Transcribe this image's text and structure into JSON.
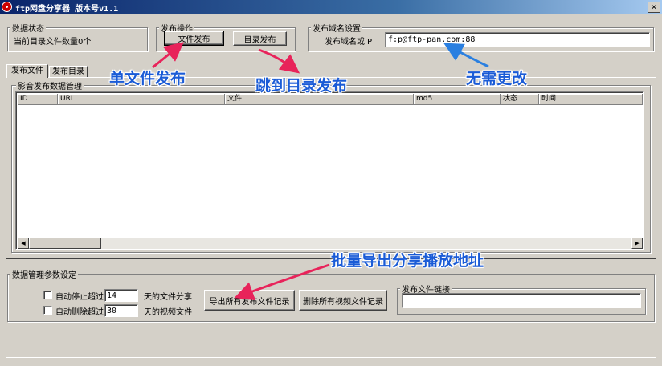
{
  "window": {
    "title": "ftp网盘分享器  版本号v1.1",
    "close_glyph": "×"
  },
  "data_status": {
    "title": "数据状态",
    "text": "当前目录文件数量0个"
  },
  "publish_ops": {
    "title": "发布操作",
    "file_publish": "文件发布",
    "dir_publish": "目录发布"
  },
  "domain": {
    "title": "发布域名设置",
    "label": "发布域名或IP",
    "value": "f:p@ftp-pan.com:88"
  },
  "tabs": [
    {
      "label": "发布文件"
    },
    {
      "label": "发布目录"
    }
  ],
  "data_mgmt": {
    "title": "影音发布数据管理"
  },
  "table": {
    "columns": [
      "ID",
      "URL",
      "文件",
      "md5",
      "状态",
      "时间"
    ]
  },
  "params": {
    "title": "数据管理参数设定",
    "auto_stop_label": "自动停止超过",
    "auto_stop_value": "14",
    "auto_stop_suffix": "天的文件分享",
    "auto_delete_label": "自动删除超过",
    "auto_delete_value": "30",
    "auto_delete_suffix": "天的视频文件",
    "export_button": "导出所有发布文件记录",
    "delete_button": "删除所有视频文件记录"
  },
  "link": {
    "title": "发布文件链接",
    "value": ""
  },
  "annotations": {
    "single_file": "单文件发布",
    "jump_dir": "跳到目录发布",
    "no_change": "无需更改",
    "batch_export": "批量导出分享播放地址"
  },
  "colors": {
    "annotation": "#1a5bd6",
    "arrow_red": "#e8235a",
    "arrow_blue": "#2a7fe0"
  }
}
